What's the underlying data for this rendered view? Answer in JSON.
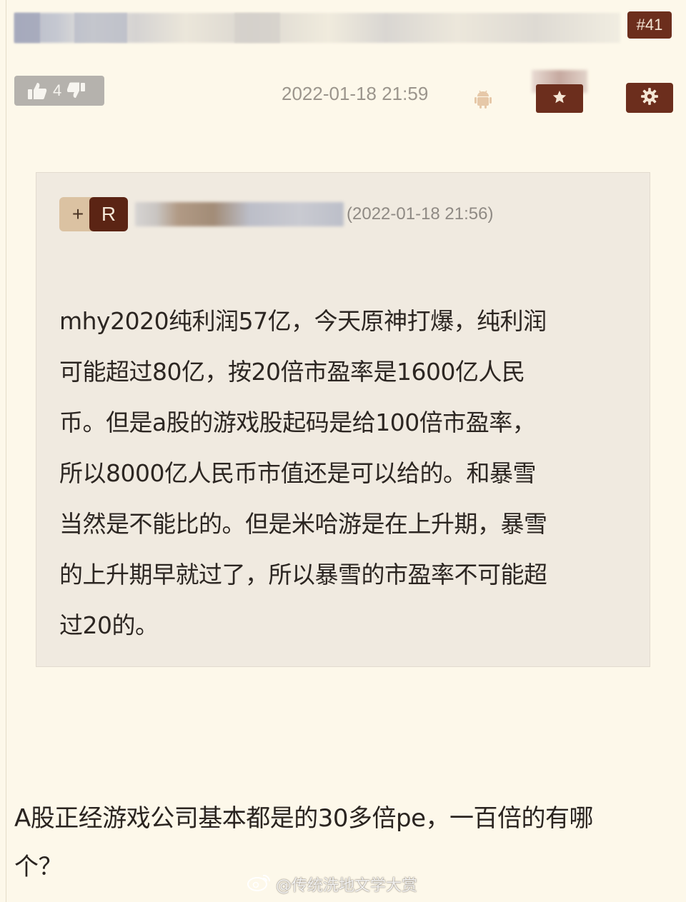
{
  "post": {
    "floor": "#41",
    "likes": "4",
    "timestamp": "2022-01-18 21:59"
  },
  "quote": {
    "plus_label": "+",
    "reply_label": "R",
    "timestamp": "(2022-01-18 21:56)",
    "lines": [
      "mhy2020纯利润57亿，今天原神打爆，纯利润",
      "可能超过80亿，按20倍市盈率是1600亿人民",
      "币。但是a股的游戏股起码是给100倍市盈率，",
      "所以8000亿人民币市值还是可以给的。和暴雪",
      "当然是不能比的。但是米哈游是在上升期，暴雪",
      "的上升期早就过了，所以暴雪的市盈率不可能超",
      "过20的。"
    ]
  },
  "reply": {
    "lines": [
      "A股正经游戏公司基本都是的30多倍pe，一百倍的有哪",
      "个？"
    ]
  },
  "watermark": "@传统洗地文学大赏",
  "colors": {
    "background": "#fdf8ea",
    "accent": "#6c2e1d",
    "quote_bg": "#f0eae0",
    "muted_text": "#9b958c"
  },
  "icons": {
    "like": "thumbs-up-icon",
    "dislike": "thumbs-down-icon",
    "device": "android-icon",
    "favorite": "star-icon",
    "settings": "gear-icon",
    "watermark": "weibo-icon"
  }
}
